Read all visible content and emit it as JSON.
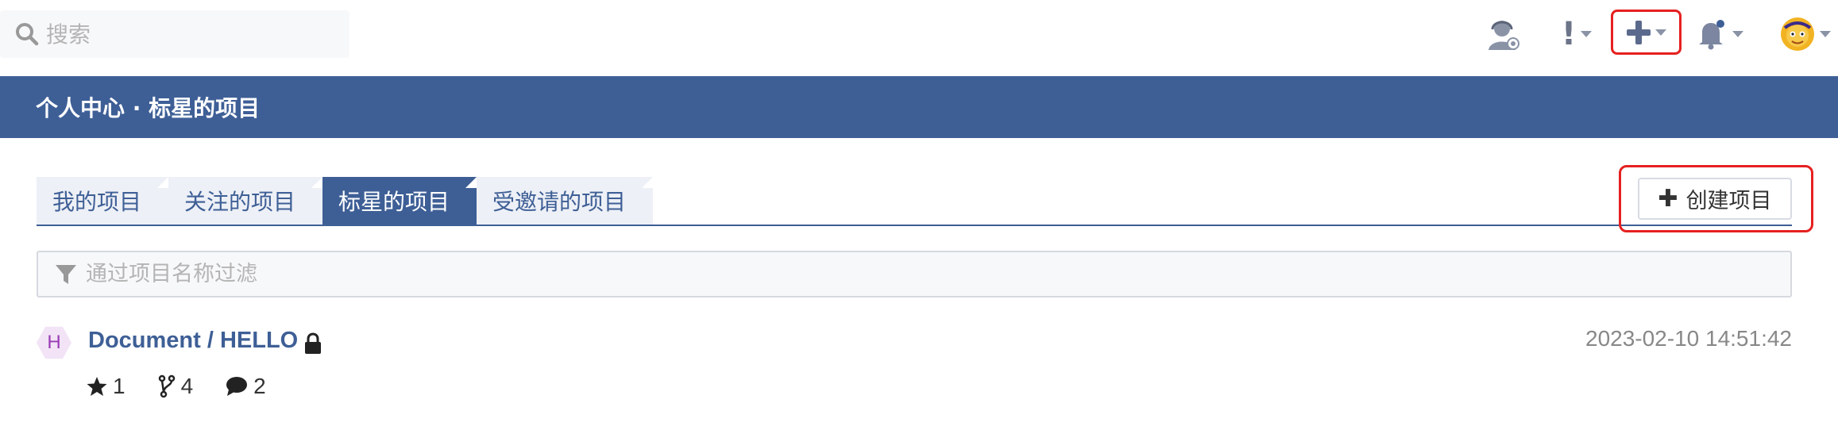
{
  "search": {
    "placeholder": "搜索"
  },
  "topbar": {
    "icons": [
      "support-icon",
      "alert-icon",
      "plus-icon",
      "bell-icon",
      "avatar"
    ],
    "alert_glyph": "!"
  },
  "banner": {
    "title": "个人中心 · 标星的项目"
  },
  "tabs": [
    {
      "label": "我的项目",
      "active": false
    },
    {
      "label": "关注的项目",
      "active": false
    },
    {
      "label": "标星的项目",
      "active": true
    },
    {
      "label": "受邀请的项目",
      "active": false
    }
  ],
  "create_button": {
    "label": "创建项目"
  },
  "filter": {
    "placeholder": "通过项目名称过滤"
  },
  "projects": [
    {
      "avatar_letter": "H",
      "name": "Document / HELLO",
      "private": true,
      "time": "2023-02-10 14:51:42",
      "stars": "1",
      "forks": "4",
      "comments": "2"
    }
  ],
  "colors": {
    "primary": "#3e5f96",
    "highlight_border": "#e62020",
    "tab_inactive_bg": "#edf0f6"
  }
}
